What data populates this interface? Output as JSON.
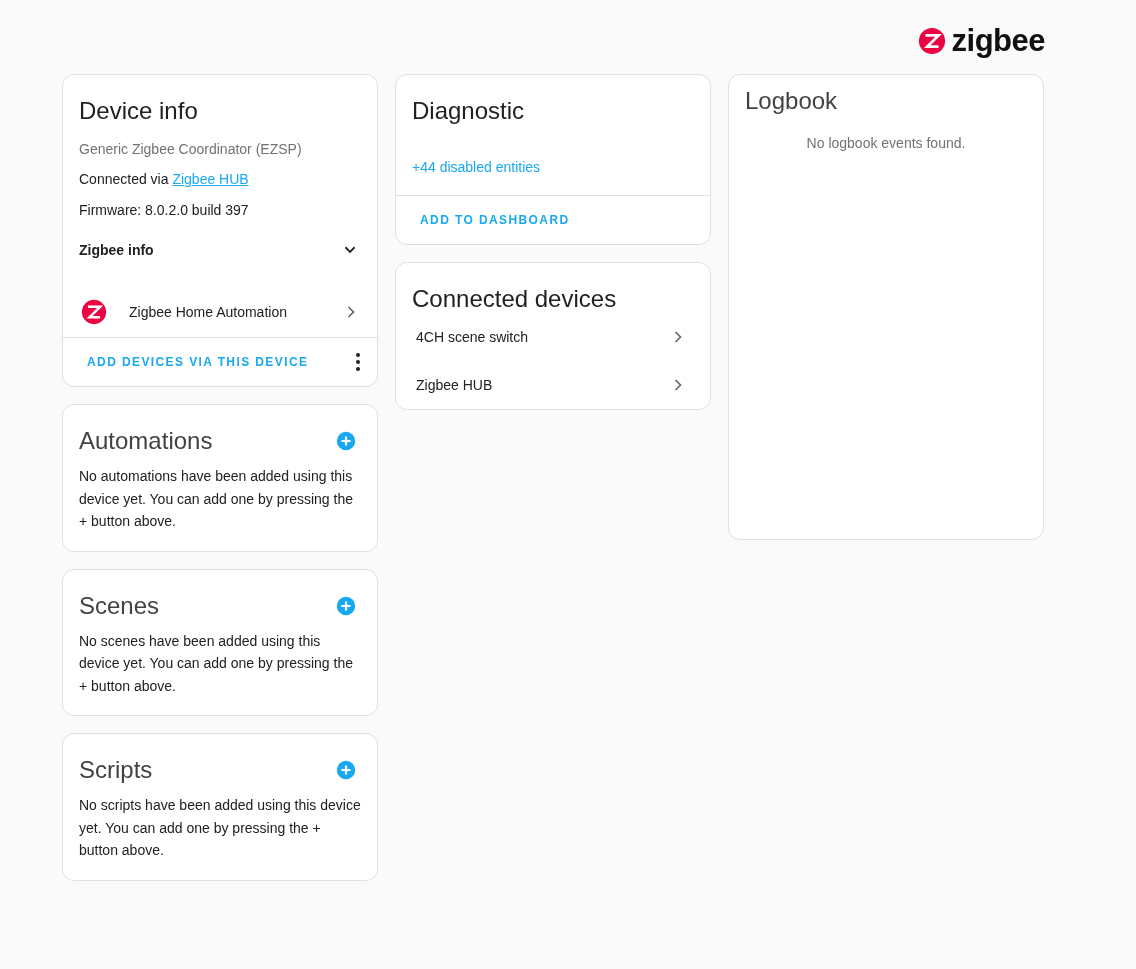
{
  "logo": {
    "text": "zigbee"
  },
  "device_info": {
    "title": "Device info",
    "model": "Generic Zigbee Coordinator (EZSP)",
    "connected_via_label": "Connected via",
    "connected_via_link": "Zigbee HUB",
    "firmware": "Firmware: 8.0.2.0 build 397",
    "expander": {
      "label": "Zigbee info",
      "expanded": false
    },
    "integration": "Zigbee Home Automation",
    "action": "ADD DEVICES VIA THIS DEVICE"
  },
  "related": [
    {
      "title": "Automations",
      "message": "No automations have been added using this device yet. You can add one by pressing the + button above."
    },
    {
      "title": "Scenes",
      "message": "No scenes have been added using this device yet. You can add one by pressing the + button above."
    },
    {
      "title": "Scripts",
      "message": "No scripts have been added using this device yet. You can add one by pressing the + button above."
    }
  ],
  "diagnostic": {
    "title": "Diagnostic",
    "disabled_entities": "+44 disabled entities",
    "action": "ADD TO DASHBOARD"
  },
  "connected_devices": {
    "title": "Connected devices",
    "items": [
      "4CH scene switch",
      "Zigbee HUB"
    ]
  },
  "logbook": {
    "title": "Logbook",
    "empty": "No logbook events found."
  }
}
